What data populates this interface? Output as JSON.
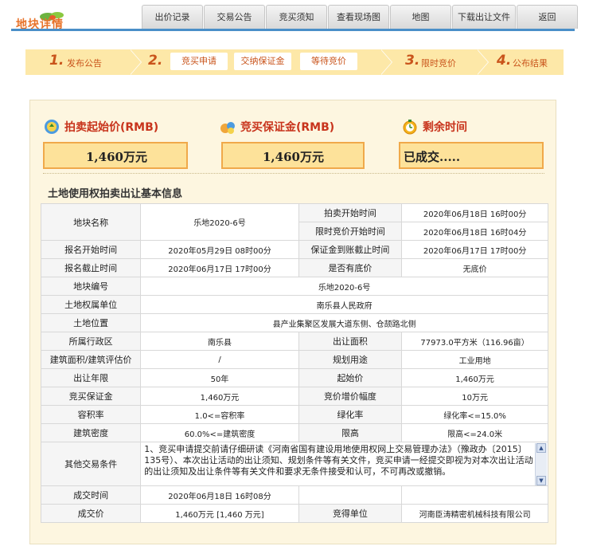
{
  "header": {
    "logo_text": "地块详情",
    "tabs": [
      "出价记录",
      "交易公告",
      "竞买须知",
      "查看现场图",
      "地图",
      "下载出让文件",
      "返回"
    ]
  },
  "steps": {
    "s1": {
      "num": "1.",
      "label": "发布公告"
    },
    "s2": {
      "num": "2.",
      "subs": [
        "竞买申请",
        "交纳保证金",
        "等待竞价"
      ]
    },
    "s3": {
      "num": "3.",
      "label": "限时竞价"
    },
    "s4": {
      "num": "4.",
      "label": "公布结果"
    }
  },
  "summary": {
    "start_price": {
      "title": "拍卖起始价(RMB)",
      "value": "1,460万元"
    },
    "deposit": {
      "title": "竞买保证金(RMB)",
      "value": "1,460万元"
    },
    "remaining": {
      "title": "剩余时间",
      "value": "已成交....."
    }
  },
  "section_title": "土地使用权拍卖出让基本信息",
  "info": {
    "parcel_name_label": "地块名称",
    "parcel_name": "乐地2020-6号",
    "auction_start_label": "拍卖开始时间",
    "auction_start": "2020年06月18日 16时00分",
    "timed_start_label": "限时竞价开始时间",
    "timed_start": "2020年06月18日 16时04分",
    "reg_start_label": "报名开始时间",
    "reg_start": "2020年05月29日 08时00分",
    "deposit_deadline_label": "保证金到账截止时间",
    "deposit_deadline": "2020年06月17日 17时00分",
    "reg_end_label": "报名截止时间",
    "reg_end": "2020年06月17日 17时00分",
    "reserve_label": "是否有底价",
    "reserve": "无底价",
    "parcel_no_label": "地块编号",
    "parcel_no": "乐地2020-6号",
    "owner_label": "土地权属单位",
    "owner": "南乐县人民政府",
    "location_label": "土地位置",
    "location": "县产业集聚区发展大道东侧、仓颉路北侧",
    "district_label": "所属行政区",
    "district": "南乐县",
    "area_label": "出让面积",
    "area": "77973.0平方米（116.96亩）",
    "building_label": "建筑面积/建筑评估价",
    "building": "/",
    "usage_label": "规划用途",
    "usage": "工业用地",
    "term_label": "出让年限",
    "term": "50年",
    "start_price_label": "起始价",
    "start_price": "1,460万元",
    "deposit_label": "竞买保证金",
    "deposit": "1,460万元",
    "increment_label": "竞价增价幅度",
    "increment": "10万元",
    "far_label": "容积率",
    "far": "1.0<=容积率",
    "green_label": "绿化率",
    "green": "绿化率<=15.0%",
    "density_label": "建筑密度",
    "density": "60.0%<=建筑密度",
    "height_label": "限高",
    "height": "限高<=24.0米",
    "other_label": "其他交易条件",
    "other": "1、竞买申请提交前请仔细研读《河南省国有建设用地使用权网上交易管理办法》（豫政办〔2015〕135号）、本次出让活动的出让须知、规划条件等有关文件，竞买申请一经提交即视为对本次出让活动的出让须知及出让条件等有关文件和要求无条件接受和认可，不可再改或撤销。",
    "deal_time_label": "成交时间",
    "deal_time": "2020年06月18日 16时08分",
    "deal_price_label": "成交价",
    "deal_price": "1,460万元 [1,460 万元]",
    "winner_label": "竞得单位",
    "winner": "河南臣涛精密机械科技有限公司"
  },
  "colors": {
    "accent_blue": "#4a8fc8",
    "step_bg": "#fde8a8",
    "title_red": "#c8341c",
    "value_box": "#fde29a"
  }
}
